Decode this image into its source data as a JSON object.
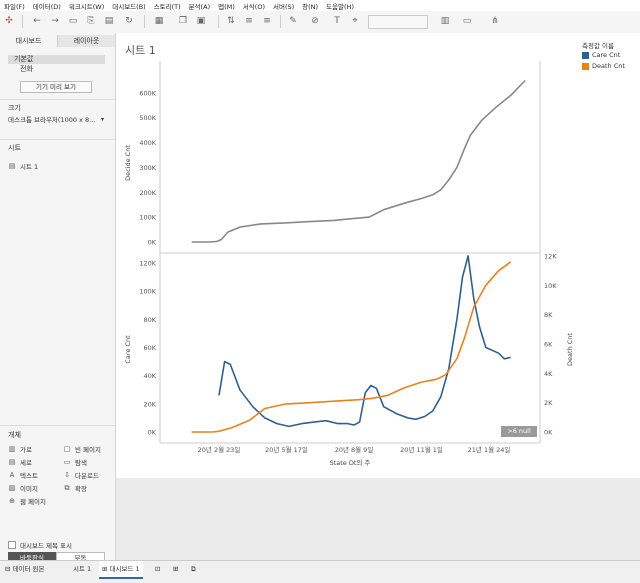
{
  "menu": [
    "파일(F)",
    "데이터(D)",
    "워크시트(W)",
    "대시보드(B)",
    "스토리(T)",
    "분석(A)",
    "맵(M)",
    "서식(O)",
    "서버(S)",
    "창(N)",
    "도움말(H)"
  ],
  "left_panel": {
    "tabs": [
      "대시보드",
      "레이아웃"
    ],
    "device": {
      "default": "기본값",
      "phone": "전화",
      "preview_button": "기기 미리 보기"
    },
    "size": {
      "title": "크기",
      "value": "데스크톱 브라우저(1000 x 8..."
    },
    "sheets": {
      "title": "시트",
      "items": [
        "시트 1"
      ]
    },
    "objects": {
      "title": "개체",
      "items": [
        {
          "label": "가로",
          "icon": "horizontal-icon"
        },
        {
          "label": "빈 페이지",
          "icon": "blank-icon"
        },
        {
          "label": "세로",
          "icon": "vertical-icon"
        },
        {
          "label": "탐색",
          "icon": "navigation-icon"
        },
        {
          "label": "텍스트",
          "icon": "text-icon"
        },
        {
          "label": "다운로드",
          "icon": "download-icon"
        },
        {
          "label": "이미지",
          "icon": "image-icon"
        },
        {
          "label": "확장",
          "icon": "extension-icon"
        },
        {
          "label": "웹 페이지",
          "icon": "web-icon"
        }
      ]
    },
    "layout_toggle": [
      "바둑판식",
      "부동"
    ],
    "show_title_label": "대시보드 제목 표시"
  },
  "sheet_title": "시트 1",
  "legend": {
    "title": "측정값 이름",
    "items": [
      {
        "label": "Care Cnt",
        "color": "#2f5f8f"
      },
      {
        "label": "Death Cnt",
        "color": "#e8821e"
      }
    ]
  },
  "null_badge": ">6 null",
  "chart_data": [
    {
      "type": "line",
      "ylabel": "Decide Cnt",
      "ylim": [
        0,
        680000
      ],
      "yticks": [
        0,
        100000,
        200000,
        300000,
        400000,
        500000,
        600000
      ],
      "ytick_labels": [
        "0K",
        "100K",
        "200K",
        "300K",
        "400K",
        "500K",
        "600K"
      ],
      "grid": false,
      "series": [
        {
          "color": "#888888",
          "x": [
            "2020-01-20",
            "2020-02-01",
            "2020-02-10",
            "2020-02-20",
            "2020-02-26",
            "2020-03-05",
            "2020-03-20",
            "2020-04-15",
            "2020-05-15",
            "2020-06-15",
            "2020-07-15",
            "2020-08-01",
            "2020-08-15",
            "2020-08-28",
            "2020-09-15",
            "2020-10-15",
            "2020-11-01",
            "2020-11-15",
            "2020-11-25",
            "2020-12-05",
            "2020-12-15",
            "2020-12-25",
            "2021-01-01",
            "2021-01-15",
            "2021-02-01",
            "2021-02-20",
            "2021-03-10"
          ],
          "y": [
            0,
            0,
            0,
            2000,
            10000,
            40000,
            60000,
            73000,
            77000,
            82000,
            87000,
            92000,
            96000,
            100000,
            130000,
            160000,
            175000,
            190000,
            210000,
            250000,
            300000,
            380000,
            430000,
            490000,
            540000,
            590000,
            650000
          ]
        }
      ]
    },
    {
      "type": "line",
      "xlabel": "State Dt의 주",
      "x_tick_labels": [
        "20년 2월 23일",
        "20년 5월 17일",
        "20년 8월 9일",
        "20년 11월 1일",
        "21년 1월 24일"
      ],
      "ylabel": "Care Cnt",
      "ylim": [
        0,
        125000
      ],
      "yticks": [
        0,
        20000,
        40000,
        60000,
        80000,
        100000,
        120000
      ],
      "ytick_labels": [
        "0K",
        "20K",
        "40K",
        "60K",
        "80K",
        "100K",
        "120K"
      ],
      "y2label": "Death Cnt",
      "y2lim": [
        0,
        12000
      ],
      "y2ticks": [
        0,
        2000,
        4000,
        6000,
        8000,
        10000,
        12000
      ],
      "y2tick_labels": [
        "0K",
        "2K",
        "4K",
        "6K",
        "8K",
        "10K",
        "12K"
      ],
      "grid": false,
      "series": [
        {
          "name": "Care Cnt",
          "color": "#2f5f8f",
          "axis": "left",
          "x": [
            "2020-02-23",
            "2020-03-01",
            "2020-03-08",
            "2020-03-20",
            "2020-04-05",
            "2020-04-20",
            "2020-05-05",
            "2020-05-20",
            "2020-06-05",
            "2020-06-20",
            "2020-07-05",
            "2020-07-20",
            "2020-08-01",
            "2020-08-09",
            "2020-08-16",
            "2020-08-23",
            "2020-08-30",
            "2020-09-06",
            "2020-09-15",
            "2020-10-01",
            "2020-10-15",
            "2020-10-25",
            "2020-11-05",
            "2020-11-15",
            "2020-11-25",
            "2020-12-05",
            "2020-12-15",
            "2020-12-22",
            "2020-12-29",
            "2021-01-05",
            "2021-01-12",
            "2021-01-20",
            "2021-01-28",
            "2021-02-05",
            "2021-02-12",
            "2021-02-20"
          ],
          "y": [
            26000,
            50000,
            48000,
            30000,
            18000,
            10000,
            6000,
            4000,
            6000,
            7000,
            8000,
            6000,
            6000,
            5000,
            7000,
            28000,
            33000,
            31000,
            18000,
            13000,
            10000,
            9000,
            11000,
            15000,
            25000,
            45000,
            80000,
            110000,
            125000,
            95000,
            75000,
            60000,
            58000,
            56000,
            52000,
            53000
          ]
        },
        {
          "name": "Death Cnt",
          "color": "#e8821e",
          "axis": "right",
          "x": [
            "2020-01-20",
            "2020-02-15",
            "2020-02-23",
            "2020-03-10",
            "2020-04-01",
            "2020-04-20",
            "2020-05-15",
            "2020-06-15",
            "2020-07-15",
            "2020-08-15",
            "2020-09-01",
            "2020-09-20",
            "2020-10-10",
            "2020-11-01",
            "2020-11-20",
            "2020-12-01",
            "2020-12-15",
            "2020-12-25",
            "2021-01-05",
            "2021-01-20",
            "2021-02-05",
            "2021-02-20"
          ],
          "y": [
            0,
            0,
            50,
            300,
            800,
            1600,
            1900,
            2000,
            2100,
            2200,
            2300,
            2500,
            3000,
            3400,
            3600,
            3900,
            5000,
            6500,
            8500,
            10000,
            11000,
            11600
          ]
        }
      ]
    }
  ]
}
